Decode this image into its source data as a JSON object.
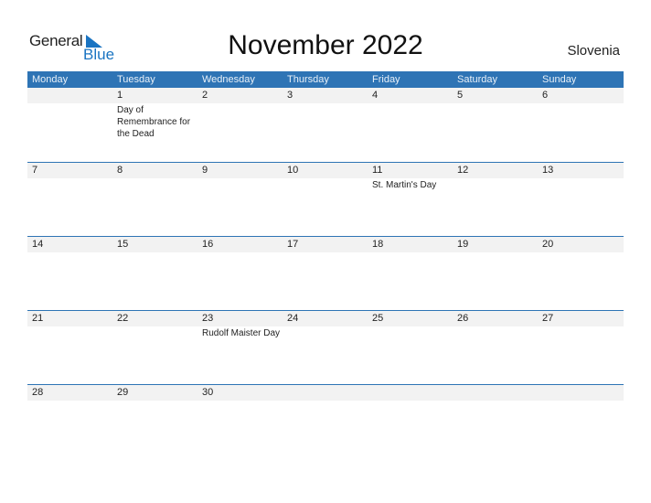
{
  "logo": {
    "general": "General",
    "blue": "Blue"
  },
  "title": "November 2022",
  "country": "Slovenia",
  "days": [
    "Monday",
    "Tuesday",
    "Wednesday",
    "Thursday",
    "Friday",
    "Saturday",
    "Sunday"
  ],
  "weeks": [
    {
      "dates": [
        "",
        "1",
        "2",
        "3",
        "4",
        "5",
        "6"
      ],
      "holidays": [
        "",
        "Day of Remembrance for the Dead",
        "",
        "",
        "",
        "",
        ""
      ]
    },
    {
      "dates": [
        "7",
        "8",
        "9",
        "10",
        "11",
        "12",
        "13"
      ],
      "holidays": [
        "",
        "",
        "",
        "",
        "St. Martin's Day",
        "",
        ""
      ]
    },
    {
      "dates": [
        "14",
        "15",
        "16",
        "17",
        "18",
        "19",
        "20"
      ],
      "holidays": [
        "",
        "",
        "",
        "",
        "",
        "",
        ""
      ]
    },
    {
      "dates": [
        "21",
        "22",
        "23",
        "24",
        "25",
        "26",
        "27"
      ],
      "holidays": [
        "",
        "",
        "Rudolf Maister Day",
        "",
        "",
        "",
        ""
      ]
    },
    {
      "dates": [
        "28",
        "29",
        "30",
        "",
        "",
        "",
        ""
      ],
      "holidays": [
        "",
        "",
        "",
        "",
        "",
        "",
        ""
      ]
    }
  ],
  "colors": {
    "accent": "#2e74b5",
    "strip": "#f2f2f2",
    "logo_blue": "#1a74c2"
  }
}
